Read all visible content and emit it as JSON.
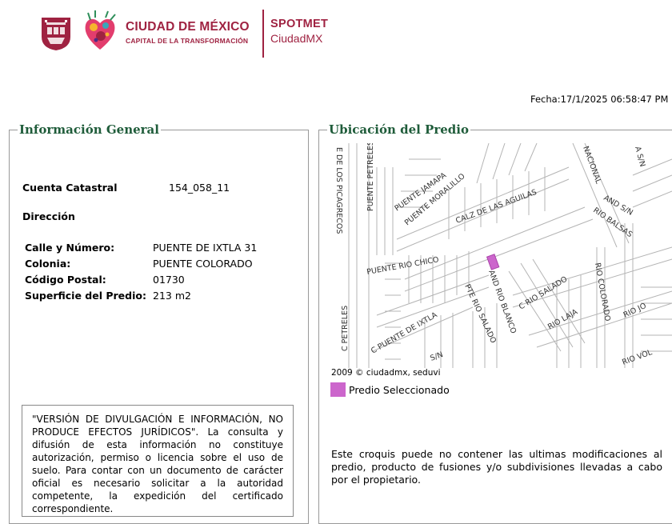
{
  "header": {
    "brand_title": "CIUDAD DE MÉXICO",
    "brand_subtitle": "CAPITAL DE LA TRANSFORMACIÓN",
    "app_name": "SPOTMET",
    "app_subtitle": "CiudadMX",
    "brand_color": "#9f2241"
  },
  "fecha": "Fecha:17/1/2025 06:58:47 PM",
  "info": {
    "legend": "Información General",
    "cuenta_label": "Cuenta Catastral",
    "cuenta_value": "154_058_11",
    "direccion_label": "Dirección",
    "rows": [
      {
        "label": "Calle y Número:",
        "value": "PUENTE DE IXTLA 31"
      },
      {
        "label": "Colonia:",
        "value": "PUENTE COLORADO"
      },
      {
        "label": "Código Postal:",
        "value": "01730"
      },
      {
        "label": "Superficie del Predio:",
        "value": "213 m2"
      }
    ],
    "disclaimer": "\"VERSIÓN DE DIVULGACIÓN E INFORMACIÓN, NO PRODUCE EFECTOS JURÍDICOS\". La consulta y difusión de esta información no constituye autorización, permiso o licencia sobre el uso de suelo. Para contar con un documento de carácter oficial es necesario solicitar a la autoridad competente, la expedición del certificado correspondiente."
  },
  "ubicacion": {
    "legend": "Ubicación del Predio",
    "map_credit": "2009 © ciudadmx, seduvi",
    "map_legend_label": "Predio Seleccionado",
    "selected_color": "#cc66cc",
    "street_labels": [
      "E DE LOS PICAGRECOS",
      "PUENTE PETRELES",
      "PUENTE JAMAPA",
      "PUENTE MORALILLO",
      "CALZ DE LAS AGUILAS",
      "NACIONAL",
      "AND S/N",
      "A S/N",
      "RIO BALSAS",
      "PUENTE RIO CHICO",
      "AND RIO BLANCO",
      "C RIO SALADO",
      "RIO COLORADO",
      "C PETRELES",
      "C PUENTE DE IXTLA",
      "PTE RIO SALADO",
      "RIO LAJA",
      "RIO JO",
      "RIO VOL",
      "S/N"
    ],
    "note": "Este croquis puede no contener las ultimas modificaciones al predio, producto de fusiones y/o subdivisiones llevadas a cabo por el propietario."
  }
}
